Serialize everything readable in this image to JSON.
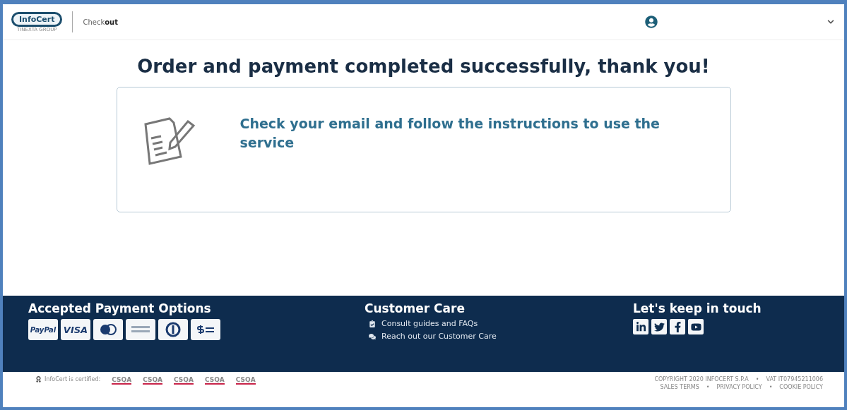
{
  "header": {
    "logo": "InfoCert",
    "logo_sub": "TINEXTA GROUP",
    "section": "Check**out**"
  },
  "main": {
    "title": "Order and payment completed successfully, thank you!",
    "message": "Check your email and follow the instructions to use the service"
  },
  "footer": {
    "payment": {
      "title": "Accepted Payment Options",
      "cards": [
        {
          "kind": "text",
          "label": "PayPal"
        },
        {
          "kind": "text",
          "label": "VISA"
        },
        {
          "kind": "circles"
        },
        {
          "kind": "amex"
        },
        {
          "kind": "diners"
        },
        {
          "kind": "cash"
        }
      ]
    },
    "care": {
      "title": "Customer Care",
      "links": [
        {
          "kind": "guide",
          "label": "Consult guides and FAQs"
        },
        {
          "kind": "chat",
          "label": "Reach out our Customer Care"
        }
      ]
    },
    "social": {
      "title": "Let's keep in touch",
      "icons": [
        {
          "kind": "linkedin"
        },
        {
          "kind": "twitter"
        },
        {
          "kind": "facebook"
        },
        {
          "kind": "youtube"
        }
      ]
    }
  },
  "bottom": {
    "certified": "InfoCert is certified:",
    "certifications": [
      "CSQA",
      "CSQA",
      "CSQA",
      "CSQA",
      "CSQA"
    ],
    "separator": "•",
    "copyright": "COPYRIGHT 2020 INFOCERT S.P.A",
    "vat": "VAT IT07945211006",
    "links": [
      "SALES TERMS",
      "PRIVACY POLICY",
      "COOKIE POLICY"
    ]
  }
}
